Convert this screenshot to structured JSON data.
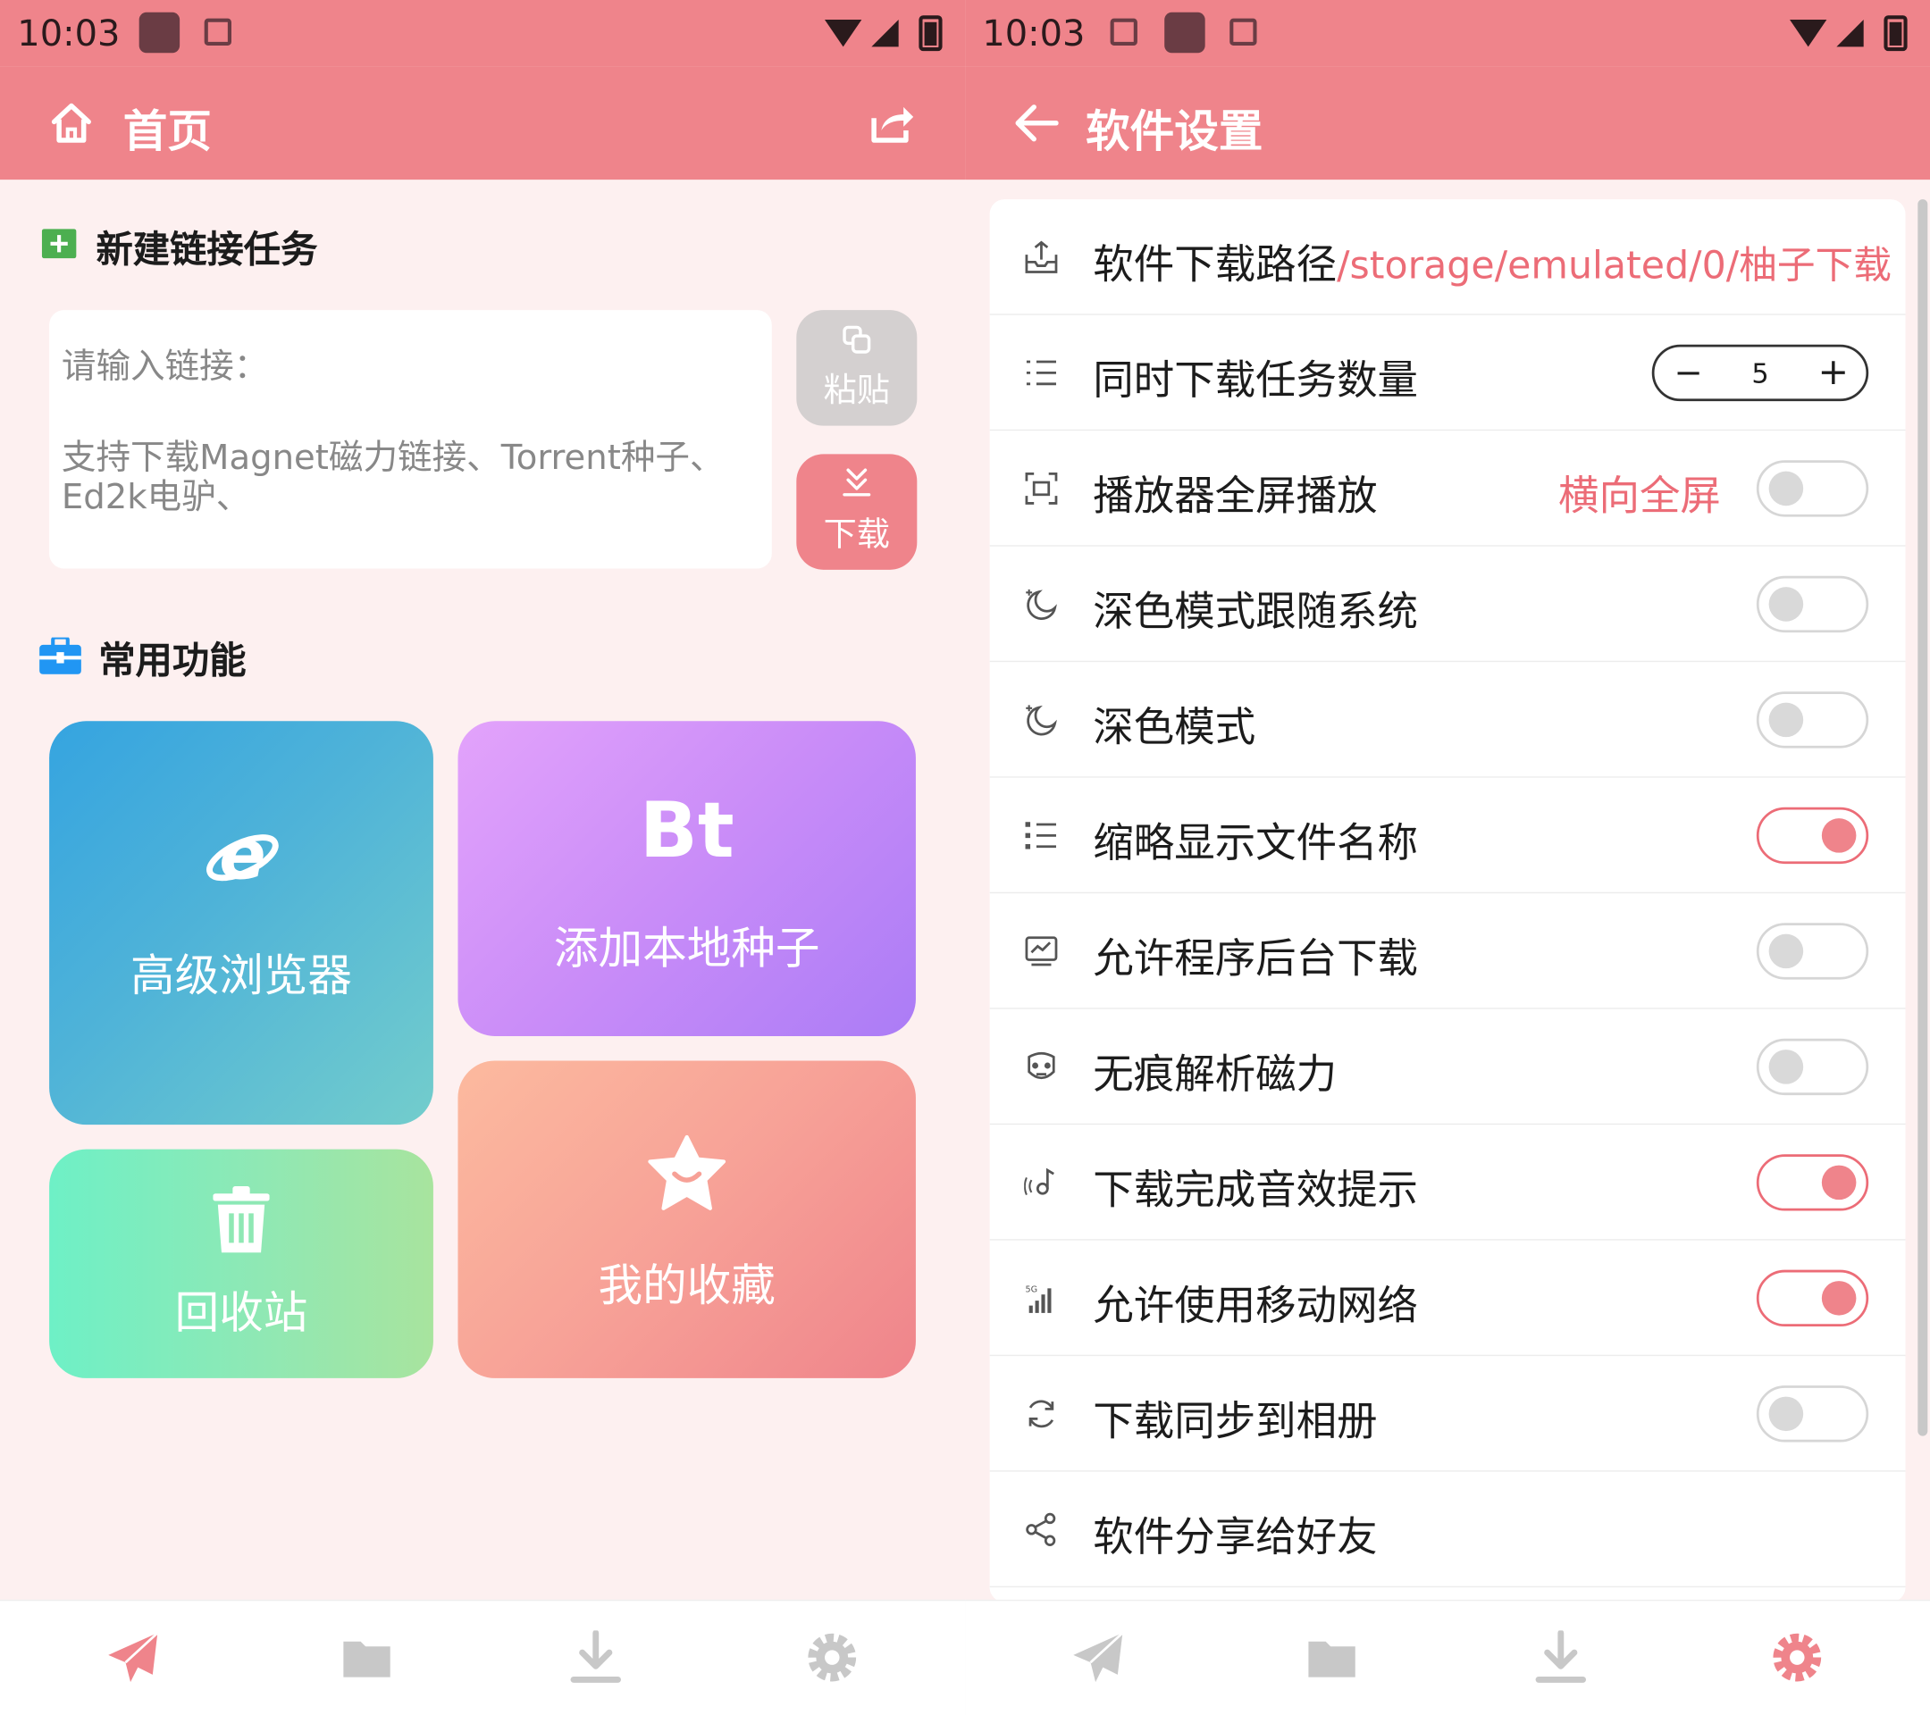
{
  "left": {
    "status_time": "10:03",
    "app_title": "首页",
    "new_task_title": "新建链接任务",
    "link_input": {
      "label": "请输入链接：",
      "hint": "支持下载Magnet磁力链接、Torrent种子、Ed2k电驴、"
    },
    "paste_label": "粘贴",
    "download_label": "下载",
    "common_title": "常用功能",
    "tiles": {
      "browser": "高级浏览器",
      "bt_mark": "Bt",
      "bt_label": "添加本地种子",
      "trash": "回收站",
      "favorites": "我的收藏"
    },
    "nav_items": [
      "send-icon",
      "folder-icon",
      "download-icon",
      "settings-icon"
    ],
    "active_nav": 0
  },
  "right": {
    "status_time": "10:03",
    "app_title": "软件设置",
    "settings": {
      "path_label": "软件下载路径",
      "path_value": "/storage/emulated/0/柚子下载",
      "concurrent_label": "同时下载任务数量",
      "concurrent_value": "5",
      "fullscreen_label": "播放器全屏播放",
      "fullscreen_value": "横向全屏",
      "fullscreen_on": false,
      "dark_follow_label": "深色模式跟随系统",
      "dark_follow_on": false,
      "dark_label": "深色模式",
      "dark_on": false,
      "short_name_label": "缩略显示文件名称",
      "short_name_on": true,
      "background_label": "允许程序后台下载",
      "background_on": false,
      "incognito_label": "无痕解析磁力",
      "incognito_on": false,
      "sound_label": "下载完成音效提示",
      "sound_on": true,
      "mobile_label": "允许使用移动网络",
      "mobile_on": true,
      "album_label": "下载同步到相册",
      "album_on": false,
      "share_label": "软件分享给好友"
    },
    "nav_items": [
      "send-icon",
      "folder-icon",
      "download-icon",
      "settings-icon"
    ],
    "active_nav": 3
  },
  "colors": {
    "accent": "#ef848b",
    "accent_text": "#ec6c77",
    "background": "#fdf0f0"
  }
}
